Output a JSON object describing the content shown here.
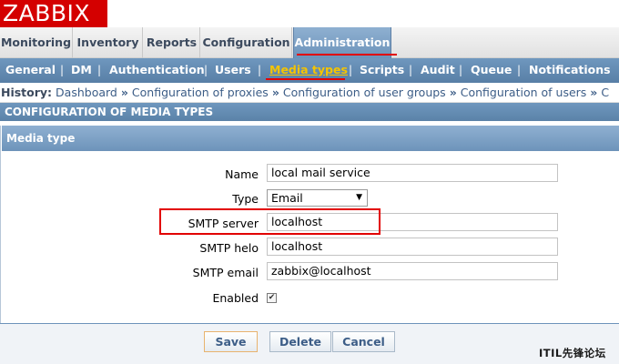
{
  "brand": {
    "logo_text": "ZABBIX",
    "color": "#d40000"
  },
  "main_menu": {
    "items": [
      {
        "label": "Monitoring"
      },
      {
        "label": "Inventory"
      },
      {
        "label": "Reports"
      },
      {
        "label": "Configuration"
      },
      {
        "label": "Administration",
        "active": true
      }
    ]
  },
  "sub_menu": {
    "items": [
      {
        "label": "General"
      },
      {
        "label": "DM"
      },
      {
        "label": "Authentication"
      },
      {
        "label": "Users"
      },
      {
        "label": "Media types",
        "active": true
      },
      {
        "label": "Scripts"
      },
      {
        "label": "Audit"
      },
      {
        "label": "Queue"
      },
      {
        "label": "Notifications"
      }
    ],
    "separator": "|"
  },
  "history": {
    "label": "History:",
    "links": [
      "Dashboard",
      "Configuration of proxies",
      "Configuration of user groups",
      "Configuration of users",
      "C"
    ],
    "arrow": "»"
  },
  "page": {
    "title": "CONFIGURATION OF MEDIA TYPES"
  },
  "form": {
    "title": "Media type",
    "fields": {
      "name": {
        "label": "Name",
        "value": "local mail service"
      },
      "type": {
        "label": "Type",
        "value": "Email"
      },
      "smtp_server": {
        "label": "SMTP server",
        "value": "localhost"
      },
      "smtp_helo": {
        "label": "SMTP helo",
        "value": "localhost"
      },
      "smtp_email": {
        "label": "SMTP email",
        "value": "zabbix@localhost"
      },
      "enabled": {
        "label": "Enabled",
        "checked": true,
        "mark": "✔"
      }
    },
    "buttons": {
      "save": "Save",
      "delete": "Delete",
      "cancel": "Cancel"
    }
  },
  "watermark": "ITIL先锋论坛",
  "colors": {
    "accent": "#6d93ba",
    "highlight": "#e20000",
    "active_sub": "#f5c400"
  }
}
